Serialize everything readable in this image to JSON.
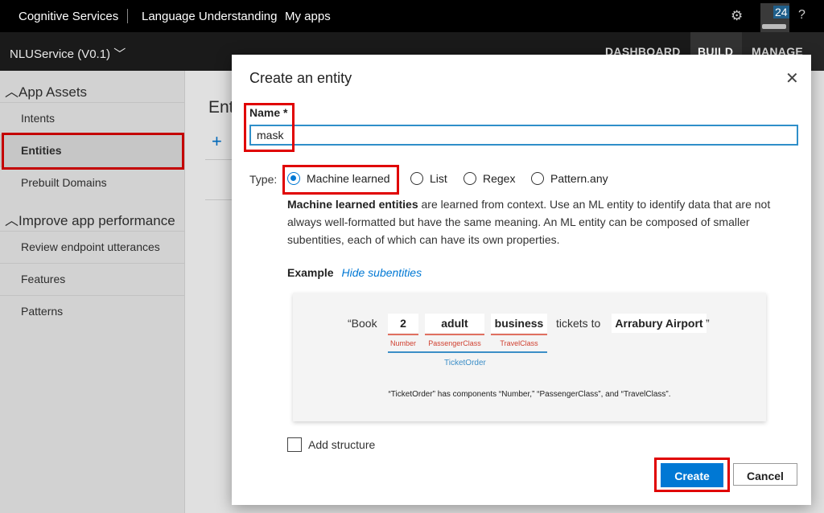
{
  "topbar": {
    "brand": "Cognitive Services",
    "product": "Language Understanding",
    "my_apps": "My apps",
    "notification_count": "24",
    "help": "?"
  },
  "appbar": {
    "app_name": "NLUService (V0.1)",
    "nav": [
      "DASHBOARD",
      "BUILD",
      "MANAGE"
    ]
  },
  "sidebar": {
    "section1": "App Assets",
    "items1": [
      "Intents",
      "Entities",
      "Prebuilt Domains"
    ],
    "section2": "Improve app performance",
    "items2": [
      "Review endpoint utterances",
      "Features",
      "Patterns"
    ],
    "active": "Entities"
  },
  "main": {
    "title_partial": "Ent",
    "add_icon": "+"
  },
  "dialog": {
    "title": "Create an entity",
    "close": "✕",
    "name_label": "Name *",
    "name_value": "mask",
    "type_label": "Type:",
    "types": [
      "Machine learned",
      "List",
      "Regex",
      "Pattern.any"
    ],
    "selected_type": "Machine learned",
    "desc_bold": "Machine learned entities",
    "desc_rest": " are learned from context. Use an ML entity to identify data that are not always well-formatted but have the same meaning. An ML entity can be composed of smaller subentities, each of which can have its own properties.",
    "example_label": "Example",
    "example_link": "Hide subentities",
    "example": {
      "open_quote": "“Book",
      "chip1": "2",
      "chip2": "adult",
      "chip3": "business",
      "middle": "tickets to",
      "chip4": "Arrabury Airport",
      "close_quote": "”",
      "sub1": "Number",
      "sub2": "PassengerClass",
      "sub3": "TravelClass",
      "parent": "TicketOrder",
      "note": "“TicketOrder” has components “Number,” “PassengerClass”, and “TravelClass”."
    },
    "add_structure": "Add structure",
    "create": "Create",
    "cancel": "Cancel"
  },
  "colors": {
    "accent": "#0078d4",
    "highlight_box": "#e00000"
  }
}
